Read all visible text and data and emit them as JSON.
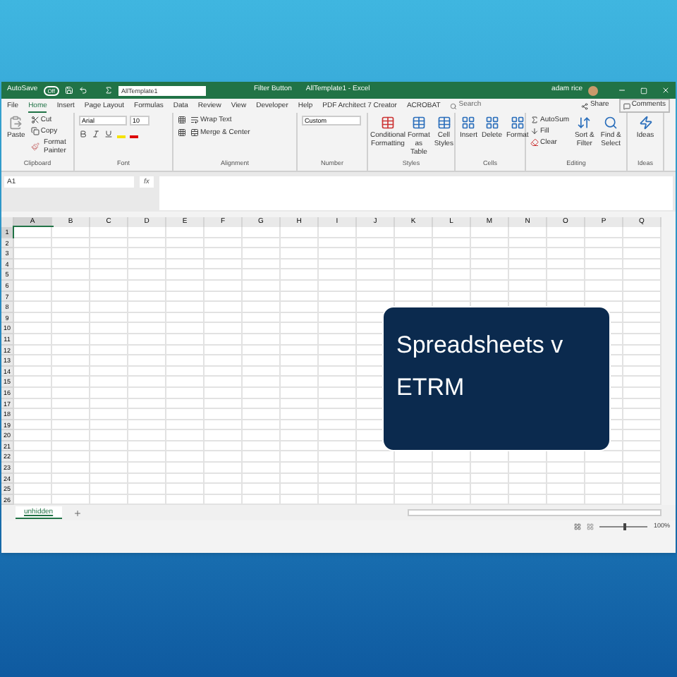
{
  "title_bar": {
    "autosave": "AutoSave",
    "autosave_toggle": {
      "label": "Off",
      "on": false
    },
    "file_field": "AllTemplate1",
    "filter_button": "Filter Button",
    "title": "AllTemplate1 - Excel",
    "user": "adam rice"
  },
  "menu_tabs": [
    {
      "label": "File",
      "selected": false
    },
    {
      "label": "Home",
      "selected": true
    },
    {
      "label": "Insert",
      "selected": false
    },
    {
      "label": "Page Layout",
      "selected": false
    },
    {
      "label": "Formulas",
      "selected": false
    },
    {
      "label": "Data",
      "selected": false
    },
    {
      "label": "Review",
      "selected": false
    },
    {
      "label": "View",
      "selected": false
    },
    {
      "label": "Developer",
      "selected": false
    },
    {
      "label": "Help",
      "selected": false
    },
    {
      "label": "PDF Architect 7 Creator",
      "selected": false
    },
    {
      "label": "ACROBAT",
      "selected": false
    }
  ],
  "search": {
    "placeholder": "Search"
  },
  "share": "Share",
  "comments": "Comments",
  "ribbon": {
    "clipboard": {
      "paste": "Paste",
      "cut": "Cut",
      "copy": "Copy",
      "format_painter": "Format Painter",
      "label": "Clipboard"
    },
    "font": {
      "name": "Arial",
      "size": "10",
      "label": "Font"
    },
    "alignment": {
      "wrap": "Wrap Text",
      "merge": "Merge & Center",
      "label": "Alignment"
    },
    "number": {
      "format": "Custom",
      "label": "Number"
    },
    "styles": {
      "items": [
        "Conditional Formatting",
        "Format as Table",
        "Cell Styles"
      ],
      "label": "Styles"
    },
    "cells": {
      "items": [
        "Insert",
        "Delete",
        "Format"
      ],
      "label": "Cells"
    },
    "editing": {
      "autosum": "AutoSum",
      "fill": "Fill",
      "clear": "Clear",
      "sort": "Sort & Filter",
      "find": "Find & Select",
      "label": "Editing"
    },
    "ideas": {
      "button": "Ideas",
      "label": "Ideas"
    }
  },
  "name_box": "A1",
  "fx": "fx",
  "columns": [
    "A",
    "B",
    "C",
    "D",
    "E",
    "F",
    "G",
    "H",
    "I",
    "J",
    "K",
    "L",
    "M",
    "N",
    "O",
    "P",
    "Q"
  ],
  "rows": [
    "1",
    "2",
    "3",
    "4",
    "5",
    "6",
    "7",
    "8",
    "9",
    "10",
    "11",
    "12",
    "13",
    "14",
    "15",
    "16",
    "17",
    "18",
    "19",
    "20",
    "21",
    "22",
    "23",
    "24",
    "25",
    "26"
  ],
  "sheet_tabs": [
    {
      "label": "unhidden",
      "selected": true
    }
  ],
  "status_bar": {
    "zoom": {
      "level": 0.5
    },
    "zoom_reading": "100%"
  },
  "overlay_card": {
    "text": "Spreadsheets v ETRM"
  }
}
